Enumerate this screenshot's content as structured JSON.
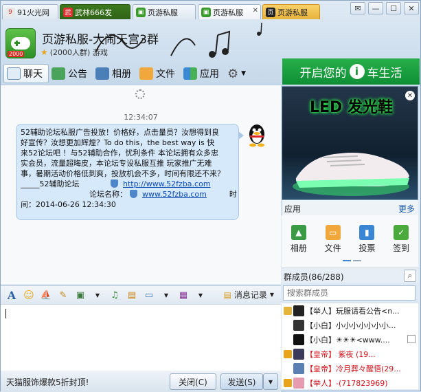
{
  "tabs": [
    {
      "label": "91火光网"
    },
    {
      "label": "武林666发"
    },
    {
      "label": "页游私服"
    },
    {
      "label": "页游私服"
    },
    {
      "label": "页游私服"
    }
  ],
  "header": {
    "title": "页游私服-大闹天宫3群",
    "subtitle": "(2000人群) 游戏",
    "avatar_badge": "2000"
  },
  "toolbar": {
    "chat": "聊天",
    "notice": "公告",
    "album": "相册",
    "files": "文件",
    "apps": "应用"
  },
  "banner": {
    "left": "开启您的",
    "badge": "i",
    "right": "车生活"
  },
  "ad": {
    "headline": "LED 发光鞋"
  },
  "chat": {
    "time": "12:34:07",
    "message_lines": [
      "52辅助论坛私服广告投放！价格好，点击量员？汝想得到良",
      "好宣传？汝想更加辉煌？To do this，the best way is 快",
      "来52论坛吧 ！与52辅助合作，忧利条件 本论坛拥有众多忠",
      "实会员，流量超晦皮，本论坛专设私服互推 玩家推广无难",
      "事，暑期活动价格低到爽，投放机会不多，时间有限还不来？"
    ],
    "signature": "_____52辅助论坛",
    "url1": "http://www.52fzba.com",
    "site_label": "论坛名称：",
    "url2": "www.52fzba.com",
    "time_label": "时",
    "datetime": "间：2014-06-26 12:34:30"
  },
  "input_toolbar": {
    "history": "消息记录"
  },
  "bottom": {
    "ad_text": "天猫服饰爆款5折封顶!",
    "close": "关闭(C)",
    "send": "发送(S)"
  },
  "apps": {
    "title": "应用",
    "more": "更多",
    "items": [
      {
        "label": "相册"
      },
      {
        "label": "文件"
      },
      {
        "label": "投票"
      },
      {
        "label": "签到"
      }
    ]
  },
  "members": {
    "title": "群成员(86/288)",
    "search_placeholder": "搜索群成员",
    "list": [
      {
        "text": "【举人】玩服请看公告<n..."
      },
      {
        "text": "【小白】小小小小小小小..."
      },
      {
        "text": "【小白】☀☀☀<www...."
      },
      {
        "text": "【皇帝】      紫夜        (19..."
      },
      {
        "text": "【皇帝】冷月葬々醒悟(29..."
      },
      {
        "text": "【举人】-(717823969)"
      }
    ]
  }
}
